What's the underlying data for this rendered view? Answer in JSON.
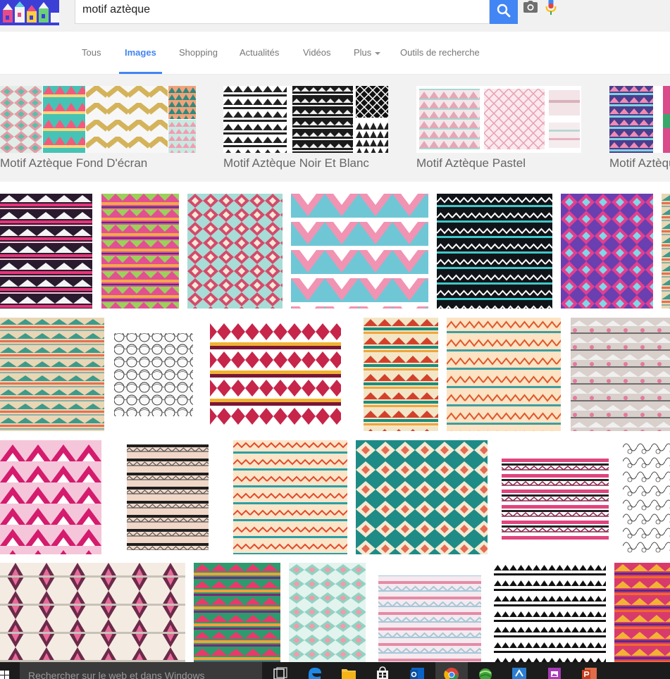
{
  "search": {
    "query": "motif aztèque"
  },
  "tabs": [
    {
      "label": "Tous"
    },
    {
      "label": "Images",
      "active": true
    },
    {
      "label": "Shopping"
    },
    {
      "label": "Actualités"
    },
    {
      "label": "Vidéos"
    },
    {
      "label": "Plus"
    },
    {
      "label": "Outils de recherche"
    }
  ],
  "related": [
    {
      "label": "Motif Aztèque Fond D'écran"
    },
    {
      "label": "Motif Aztèque Noir Et Blanc"
    },
    {
      "label": "Motif Aztèque Pastel"
    },
    {
      "label": "Motif Aztèque"
    }
  ],
  "taskbar": {
    "search_placeholder": "Rechercher sur le web et dans Windows"
  },
  "icons": {
    "camera": "camera-icon",
    "mic": "microphone-icon",
    "search": "search-icon"
  },
  "colors": {
    "accent": "#4285f4",
    "header_bg": "#f1f1f1"
  }
}
